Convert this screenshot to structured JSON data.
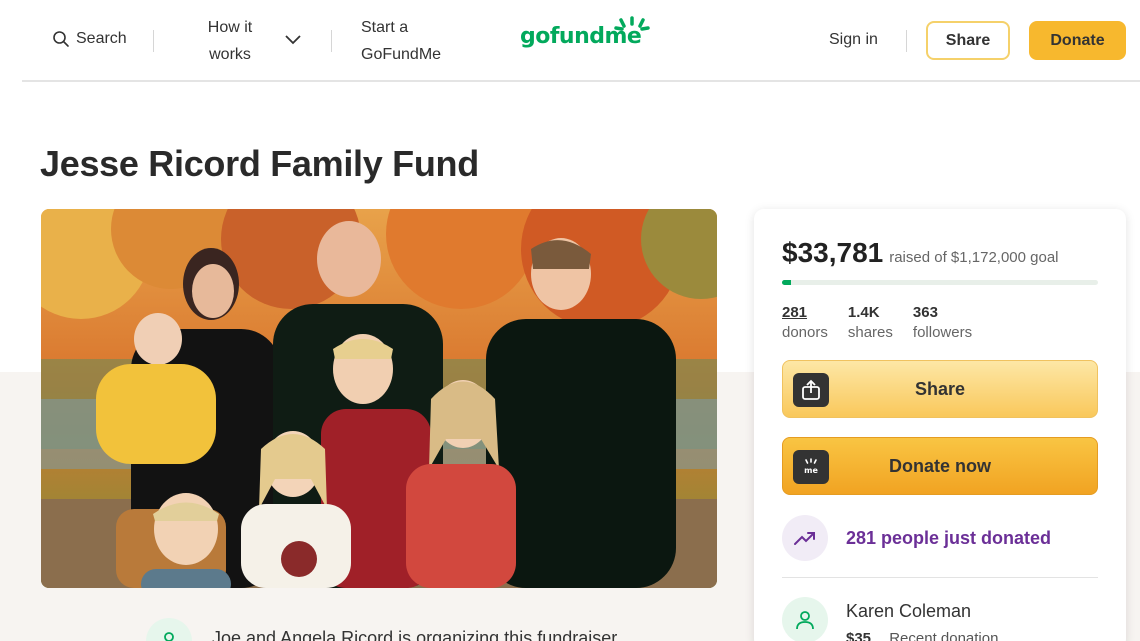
{
  "header": {
    "search_label": "Search",
    "how_it_works": "How it works",
    "start_label": "Start a GoFundMe",
    "logo_text": "gofundme",
    "sign_in": "Sign in",
    "share_label": "Share",
    "donate_label": "Donate"
  },
  "fundraiser": {
    "title": "Jesse Ricord Family Fund",
    "photo_alt": "Family photo in autumn setting"
  },
  "card": {
    "raised_amount": "$33,781",
    "goal_text": "raised of $1,172,000 goal",
    "progress_fraction": 0.029,
    "stats": [
      {
        "number": "281",
        "label": "donors"
      },
      {
        "number": "1.4K",
        "label": "shares"
      },
      {
        "number": "363",
        "label": "followers"
      }
    ],
    "share_button": "Share",
    "donate_button": "Donate now",
    "trend_text": "281 people just donated",
    "recent_donor": {
      "name": "Karen Coleman",
      "amount": "$35",
      "note": "Recent donation"
    }
  },
  "organizer_text": "Joe and Angela Ricord is organizing this fundraiser.",
  "colors": {
    "brand_green": "#02a95c",
    "donate_yellow": "#f7b82e",
    "trend_purple": "#6b2f97"
  }
}
